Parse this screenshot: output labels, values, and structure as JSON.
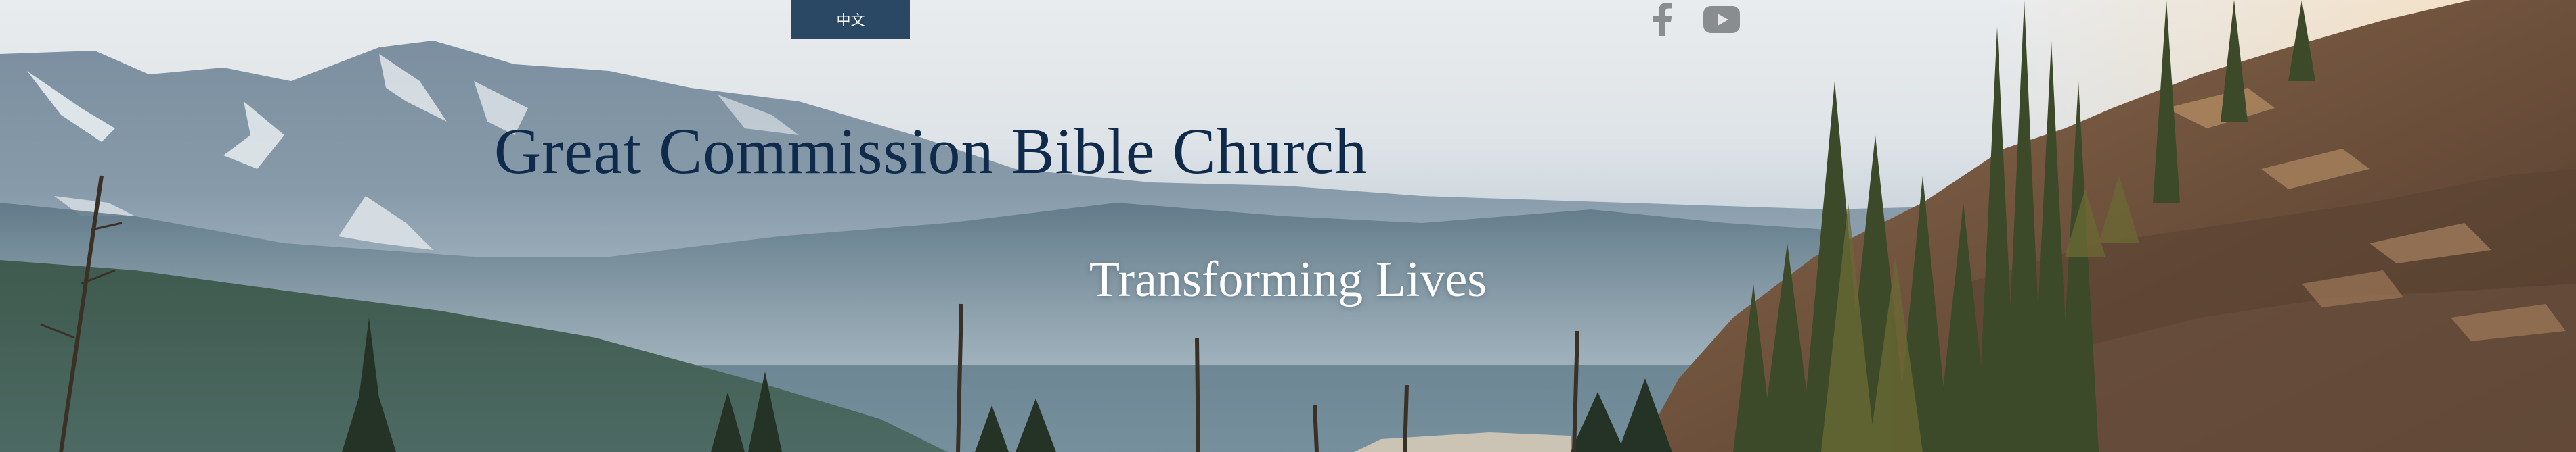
{
  "header": {
    "language_label": "中文",
    "social": [
      {
        "name": "facebook",
        "icon": "facebook-icon"
      },
      {
        "name": "youtube",
        "icon": "youtube-icon"
      }
    ]
  },
  "hero": {
    "title": "Great Commission Bible Church",
    "tagline": "Transforming Lives"
  },
  "colors": {
    "title_text": "#0f2a4a",
    "language_button_bg": "#2a4763",
    "social_icon": "#8a8d90"
  }
}
